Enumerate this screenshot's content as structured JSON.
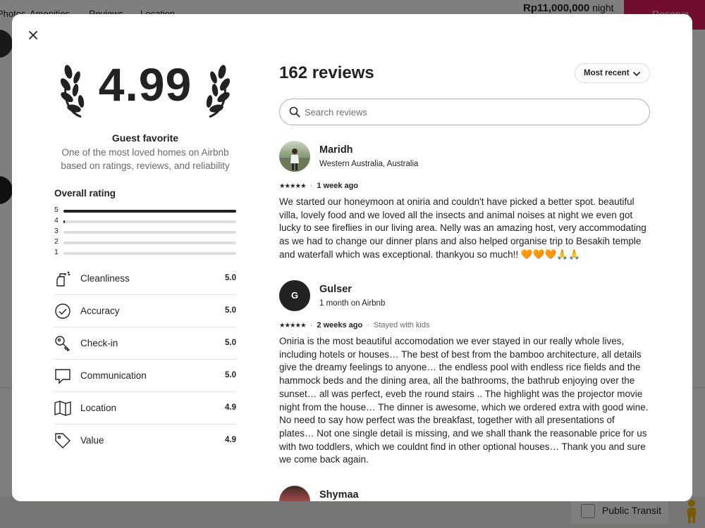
{
  "background": {
    "nav_tabs": [
      "Photos",
      "Amenities",
      "Reviews",
      "Location"
    ],
    "price": "Rp11,000,000",
    "price_unit": "night",
    "reserve_label": "Reserve",
    "transit_label": "Public Transit"
  },
  "modal": {
    "rating": "4.99",
    "guest_favorite_title": "Guest favorite",
    "guest_favorite_desc": "One of the most loved homes on Airbnb based on ratings, reviews, and reliability",
    "overall_rating_title": "Overall rating",
    "distribution": [
      {
        "label": "5",
        "fraction": 1.0
      },
      {
        "label": "4",
        "fraction": 0.01
      },
      {
        "label": "3",
        "fraction": 0
      },
      {
        "label": "2",
        "fraction": 0
      },
      {
        "label": "1",
        "fraction": 0
      }
    ],
    "categories": [
      {
        "name": "Cleanliness",
        "value": "5.0",
        "icon": "spray-bottle-icon"
      },
      {
        "name": "Accuracy",
        "value": "5.0",
        "icon": "check-circle-icon"
      },
      {
        "name": "Check-in",
        "value": "5.0",
        "icon": "key-icon"
      },
      {
        "name": "Communication",
        "value": "5.0",
        "icon": "chat-bubble-icon"
      },
      {
        "name": "Location",
        "value": "4.9",
        "icon": "map-icon"
      },
      {
        "name": "Value",
        "value": "4.9",
        "icon": "tag-icon"
      }
    ],
    "review_count": "162 reviews",
    "sort_label": "Most recent",
    "search_placeholder": "Search reviews",
    "reviews": [
      {
        "name": "Maridh",
        "subtitle": "Western Australia, Australia",
        "avatar": "photo",
        "stars": "★★★★★",
        "when": "1 week ago",
        "extra": "",
        "text": "We started our honeymoon at oniria and couldn't have picked a better spot. beautiful villa, lovely food and we loved all the insects and animal noises at night we even got lucky to see fireflies in our living area. Nelly was an amazing host, very accommodating as we had to change our dinner plans and also helped organise trip to Besakih temple and waterfall which was exceptional. thankyou so much!! 🧡🧡🧡🙏🙏"
      },
      {
        "name": "Gulser",
        "subtitle": "1 month on Airbnb",
        "avatar": "G",
        "stars": "★★★★★",
        "when": "2 weeks ago",
        "extra": "Stayed with kids",
        "text": "Oniria is the most beautiful accomodation we ever stayed in our really whole lives, including hotels or houses… The best of best from the bamboo architecture, all details give the dreamy feelings to anyone… the endless pool with endless rice fields and the hammock beds and the dining area, all the bathrooms, the bathrub enjoying over the sunset… all was perfect, eveb the round stairs .. The highlight was the projector movie night from the house… The dinner is awesome, which we ordered extra with good wine. No need to say how perfect was the breakfast, together with all presentations of plates… Not one single detail is missing, and we shall thank the reasonable price for us with two toddlers, which we couldnt find in other optional houses… Thank you and sure we come back again."
      },
      {
        "name": "Shymaa",
        "avatar": "photo"
      }
    ]
  }
}
